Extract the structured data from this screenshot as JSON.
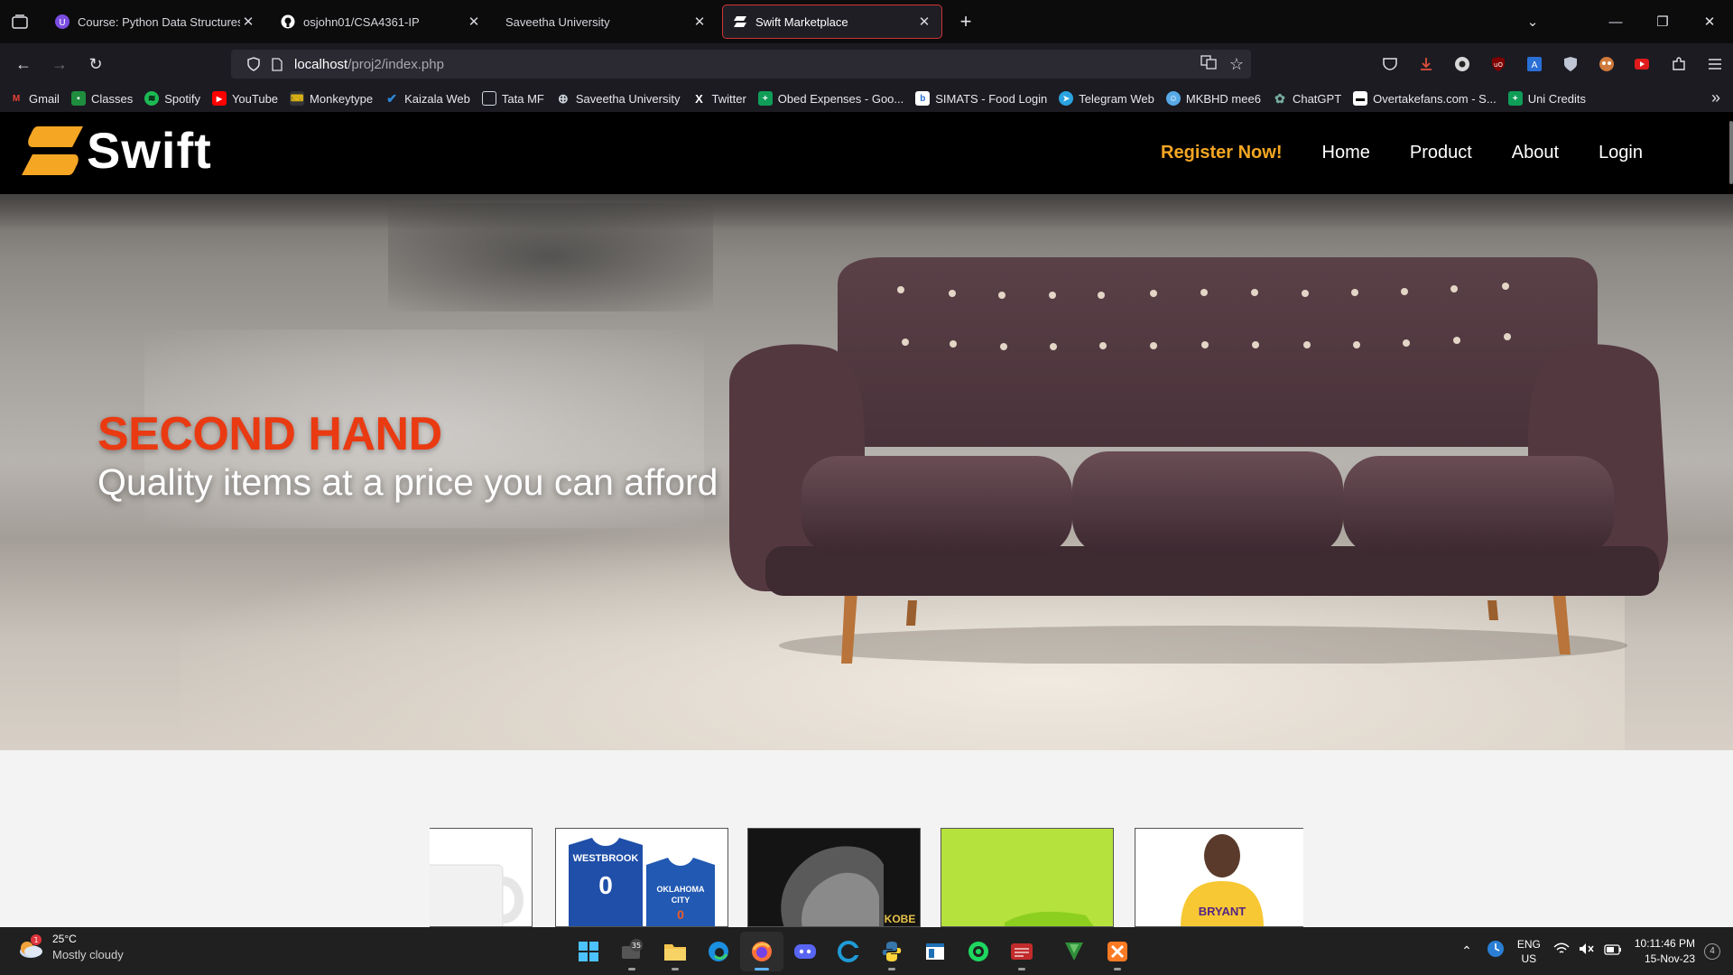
{
  "browser": {
    "tabs": [
      {
        "title": "Course: Python Data Structures",
        "favicon": "course-icon"
      },
      {
        "title": "osjohn01/CSA4361-IP",
        "favicon": "github-icon"
      },
      {
        "title": "Saveetha University",
        "favicon": "none"
      },
      {
        "title": "Swift Marketplace",
        "favicon": "swift-icon",
        "active": true
      }
    ],
    "url": {
      "host": "localhost",
      "path": "/proj2/index.php"
    },
    "bookmarks": [
      {
        "label": "Gmail",
        "icon": "gmail-icon",
        "color": "#ea4335"
      },
      {
        "label": "Classes",
        "icon": "classroom-icon",
        "color": "#1e8e3e"
      },
      {
        "label": "Spotify",
        "icon": "spotify-icon",
        "color": "#1db954"
      },
      {
        "label": "YouTube",
        "icon": "youtube-icon",
        "color": "#ff0000"
      },
      {
        "label": "Monkeytype",
        "icon": "monkeytype-icon",
        "color": "#e2b714"
      },
      {
        "label": "Kaizala Web",
        "icon": "kaizala-icon",
        "color": "#2b88d8"
      },
      {
        "label": "Tata MF",
        "icon": "page-icon",
        "color": "#cfd8dc"
      },
      {
        "label": "Saveetha University",
        "icon": "globe-icon",
        "color": "#cfd8dc"
      },
      {
        "label": "Twitter",
        "icon": "x-icon",
        "color": "#ffffff"
      },
      {
        "label": "Obed Expenses - Goo...",
        "icon": "sheets-icon",
        "color": "#0f9d58"
      },
      {
        "label": "SIMATS - Food Login",
        "icon": "page-icon",
        "color": "#cfd8dc"
      },
      {
        "label": "Telegram Web",
        "icon": "telegram-icon",
        "color": "#2aa3e0"
      },
      {
        "label": "MKBHD mee6",
        "icon": "mee6-icon",
        "color": "#57a9e6"
      },
      {
        "label": "ChatGPT",
        "icon": "chatgpt-icon",
        "color": "#74aa9c"
      },
      {
        "label": "Overtakefans.com - S...",
        "icon": "page-icon",
        "color": "#cfd8dc"
      },
      {
        "label": "Uni Credits",
        "icon": "sheets-icon",
        "color": "#0f9d58"
      }
    ]
  },
  "site": {
    "brand": "Swift",
    "nav": {
      "register": "Register Now!",
      "home": "Home",
      "product": "Product",
      "about": "About",
      "login": "Login"
    },
    "hero": {
      "title": "SECOND HAND",
      "subtitle": "Quality items at a price you can afford"
    },
    "colors": {
      "accent": "#f5a623",
      "hero_title": "#ea3a12",
      "header_bg": "#000000"
    }
  },
  "taskbar": {
    "weather": {
      "temp": "25°C",
      "condition": "Mostly cloudy",
      "badge": "1"
    },
    "task_view_badge": "35",
    "lang": {
      "line1": "ENG",
      "line2": "US"
    },
    "clock": {
      "time": "10:11:46 PM",
      "date": "15-Nov-23"
    },
    "notifications": "4"
  }
}
